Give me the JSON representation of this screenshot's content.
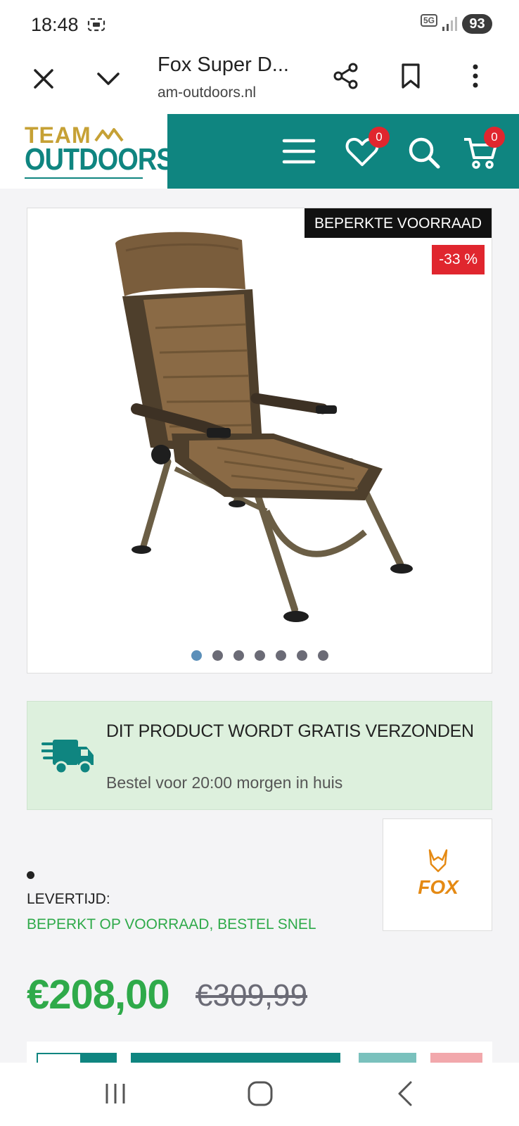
{
  "status_bar": {
    "time": "18:48",
    "network": "5G",
    "battery": "93"
  },
  "browser": {
    "title": "Fox Super D...",
    "url": "am-outdoors.nl"
  },
  "header": {
    "logo_top": "TEAM",
    "logo_bottom": "OUTDOORS",
    "wishlist_count": "0",
    "cart_count": "0",
    "accent": "#0f8580"
  },
  "product": {
    "tag_limited": "BEPERKTE VOORRAAD",
    "tag_discount": "-33 %",
    "image_count": 7,
    "active_image": 0
  },
  "shipping": {
    "title": "DIT PRODUCT WORDT GRATIS VERZONDEN",
    "subtitle": "Bestel voor 20:00 morgen in huis"
  },
  "brand": {
    "name": "FOX"
  },
  "delivery": {
    "label": "LEVERTIJD:",
    "value": "BEPERKT OP VOORRAAD, BESTEL SNEL"
  },
  "price": {
    "current": "€208,00",
    "old": "€309,99",
    "color": "#2faa4a"
  }
}
